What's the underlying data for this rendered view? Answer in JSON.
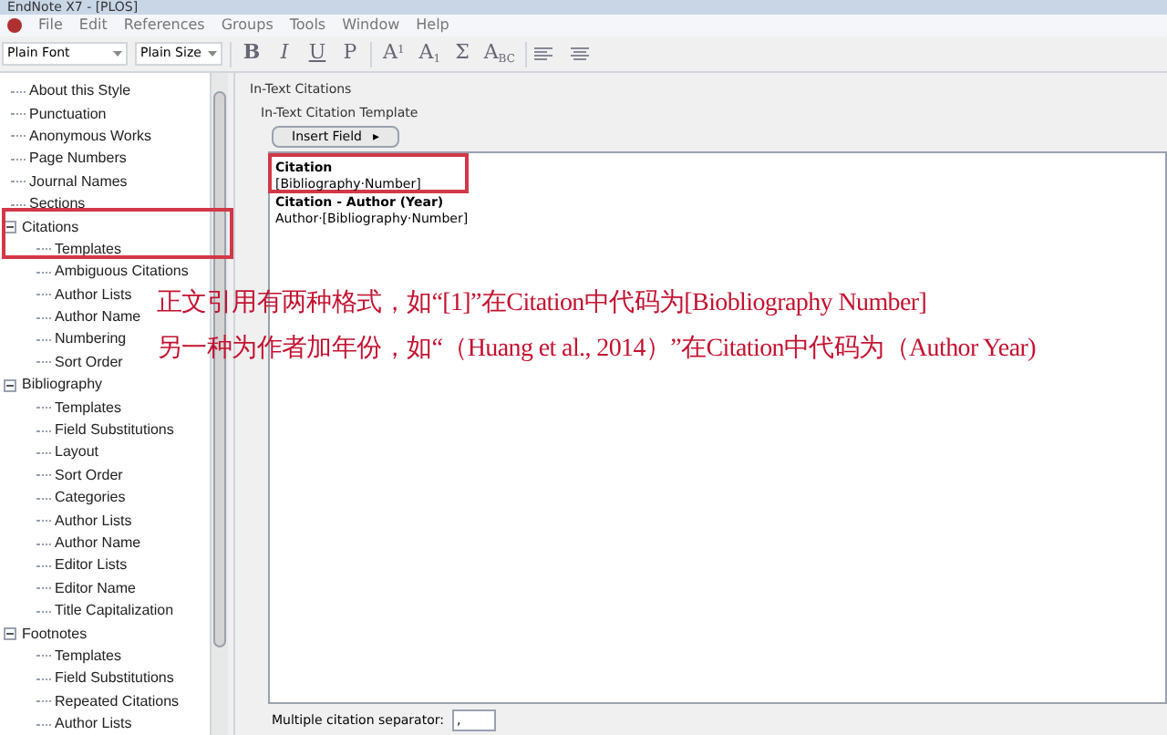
{
  "window": {
    "title": "EndNote X7 - [PLOS]"
  },
  "menu": [
    "File",
    "Edit",
    "References",
    "Groups",
    "Tools",
    "Window",
    "Help"
  ],
  "toolbar": {
    "font": "Plain Font",
    "size": "Plain Size",
    "format_buttons": [
      "B",
      "I",
      "U",
      "P"
    ],
    "script_buttons": [
      "A$^{1}$",
      "A$_{1}$",
      "Σ",
      "A$_{BC}$"
    ]
  },
  "tree": [
    {
      "label": "About this Style"
    },
    {
      "label": "Punctuation"
    },
    {
      "label": "Anonymous Works"
    },
    {
      "label": "Page Numbers"
    },
    {
      "label": "Journal Names"
    },
    {
      "label": "Sections"
    },
    {
      "label": "Citations",
      "expanded": true,
      "children": [
        {
          "label": "Templates"
        },
        {
          "label": "Ambiguous Citations"
        },
        {
          "label": "Author Lists"
        },
        {
          "label": "Author Name"
        },
        {
          "label": "Numbering"
        },
        {
          "label": "Sort Order"
        }
      ]
    },
    {
      "label": "Bibliography",
      "expanded": true,
      "children": [
        {
          "label": "Templates"
        },
        {
          "label": "Field Substitutions"
        },
        {
          "label": "Layout"
        },
        {
          "label": "Sort Order"
        },
        {
          "label": "Categories"
        },
        {
          "label": "Author Lists"
        },
        {
          "label": "Author Name"
        },
        {
          "label": "Editor Lists"
        },
        {
          "label": "Editor Name"
        },
        {
          "label": "Title Capitalization"
        }
      ]
    },
    {
      "label": "Footnotes",
      "expanded": true,
      "children": [
        {
          "label": "Templates"
        },
        {
          "label": "Field Substitutions"
        },
        {
          "label": "Repeated Citations"
        },
        {
          "label": "Author Lists"
        }
      ]
    }
  ],
  "panel": {
    "title": "In-Text Citations",
    "group_title": "In-Text Citation Template",
    "insert_button": "Insert Field",
    "insert_caret": "▸",
    "templates": [
      {
        "heading": "Citation",
        "code": "[Bibliography·Number]"
      },
      {
        "heading": "Citation - Author (Year)",
        "code": "Author·[Bibliography·Number]"
      }
    ],
    "separator_label": "Multiple citation separator:",
    "separator_value": ","
  },
  "annotation": [
    "正文引用有两种格式，如“[1]”在Citation中代码为[Biobliography Number]",
    "另一种为作者加年份，如“（Huang et al., 2014）”在Citation中代码为（Author Year)"
  ]
}
